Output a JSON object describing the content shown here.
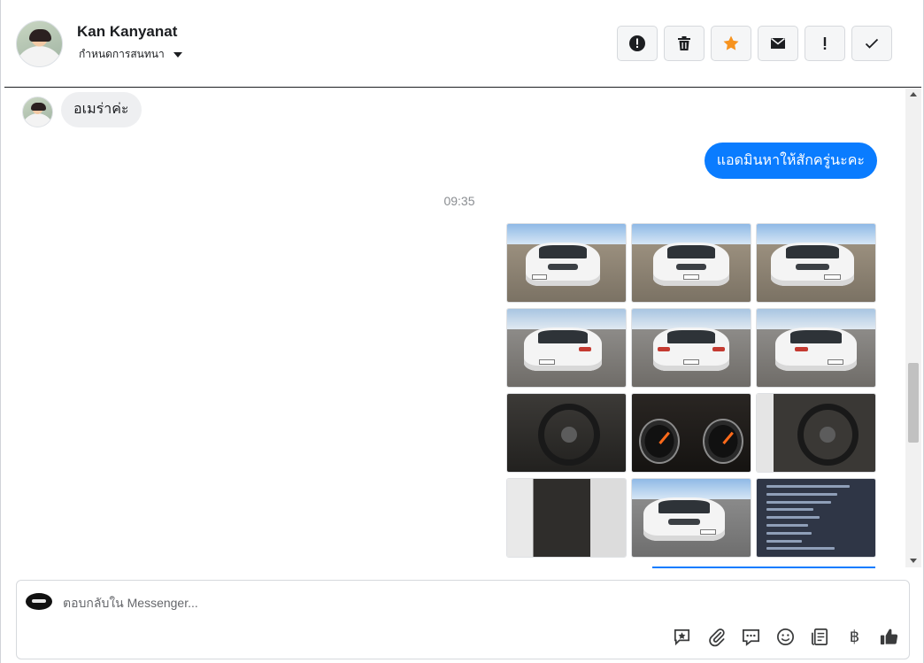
{
  "header": {
    "contact_name": "Kan Kanyanat",
    "assign_label": "กำหนดการสนทนา",
    "actions": [
      {
        "name": "spam-button",
        "icon": "exclamation-circle-icon"
      },
      {
        "name": "delete-button",
        "icon": "trash-icon"
      },
      {
        "name": "star-button",
        "icon": "star-icon",
        "color": "#f7931e"
      },
      {
        "name": "mark-unread-button",
        "icon": "envelope-icon"
      },
      {
        "name": "follow-up-button",
        "icon": "exclamation-icon"
      },
      {
        "name": "mark-done-button",
        "icon": "checkmark-icon"
      }
    ]
  },
  "conversation": {
    "incoming_message": "อเมร่าค่ะ",
    "outgoing_message": "แอดมินหาให้สักครู่นะคะ",
    "timestamp": "09:35",
    "photo_count": 12,
    "bubble_color": "#0a7cff"
  },
  "composer": {
    "placeholder": "ตอบกลับใน Messenger...",
    "tools": [
      "saved-reply-icon",
      "paperclip-icon",
      "chat-bubble-icon",
      "emoji-icon",
      "receipt-icon",
      "baht-icon",
      "thumbs-up-icon"
    ],
    "baht_symbol": "฿"
  }
}
